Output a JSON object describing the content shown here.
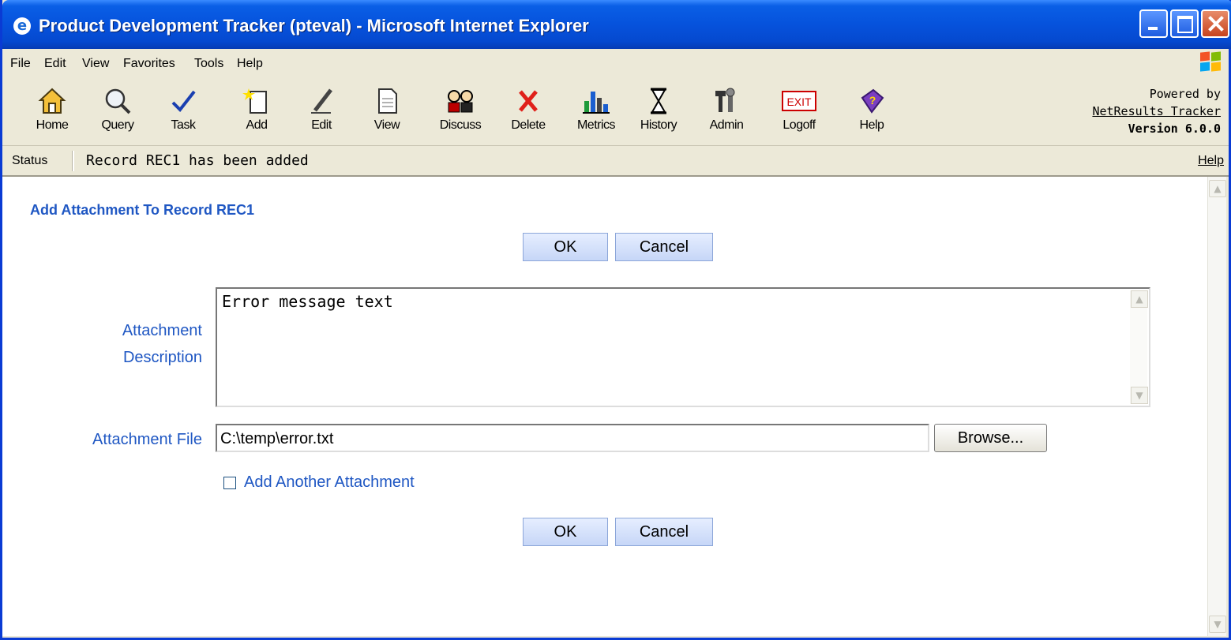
{
  "window": {
    "title": "Product Development Tracker (pteval) - Microsoft Internet Explorer",
    "app_icon": "ie-icon",
    "controls": [
      "minimize-icon",
      "maximize-icon",
      "close-icon"
    ]
  },
  "menu": {
    "items": [
      "File",
      "Edit",
      "View",
      "Favorites",
      "Tools",
      "Help"
    ]
  },
  "toolbar": {
    "items": [
      {
        "label": "Home",
        "icon": "home-icon"
      },
      {
        "label": "Query",
        "icon": "magnifier-icon"
      },
      {
        "label": "Task",
        "icon": "checkmark-icon"
      },
      {
        "label": "Add",
        "icon": "new-document-icon"
      },
      {
        "label": "Edit",
        "icon": "pencil-icon"
      },
      {
        "label": "View",
        "icon": "document-icon"
      },
      {
        "label": "Discuss",
        "icon": "people-icon"
      },
      {
        "label": "Delete",
        "icon": "red-x-icon"
      },
      {
        "label": "Metrics",
        "icon": "bar-chart-icon"
      },
      {
        "label": "History",
        "icon": "hourglass-icon"
      },
      {
        "label": "Admin",
        "icon": "tools-icon"
      },
      {
        "label": "Logoff",
        "icon": "exit-sign-icon",
        "sign_text": "EXIT"
      },
      {
        "label": "Help",
        "icon": "help-book-icon"
      }
    ],
    "powered_by": {
      "line1": "Powered by",
      "link": "NetResults Tracker",
      "version": "Version 6.0.0"
    }
  },
  "status": {
    "label": "Status",
    "message": "Record REC1 has been added",
    "help": "Help"
  },
  "form": {
    "title": "Add Attachment To Record REC1",
    "ok_label": "OK",
    "cancel_label": "Cancel",
    "description_label_line1": "Attachment",
    "description_label_line2": "Description",
    "description_value": "Error message text",
    "file_label": "Attachment File",
    "file_value": "C:\\temp\\error.txt",
    "browse_label": "Browse...",
    "add_another_label": "Add Another Attachment",
    "add_another_checked": false
  },
  "colors": {
    "link_blue": "#1f57c3",
    "titlebar_blue": "#0652dc",
    "chrome_beige": "#ece9d8"
  }
}
